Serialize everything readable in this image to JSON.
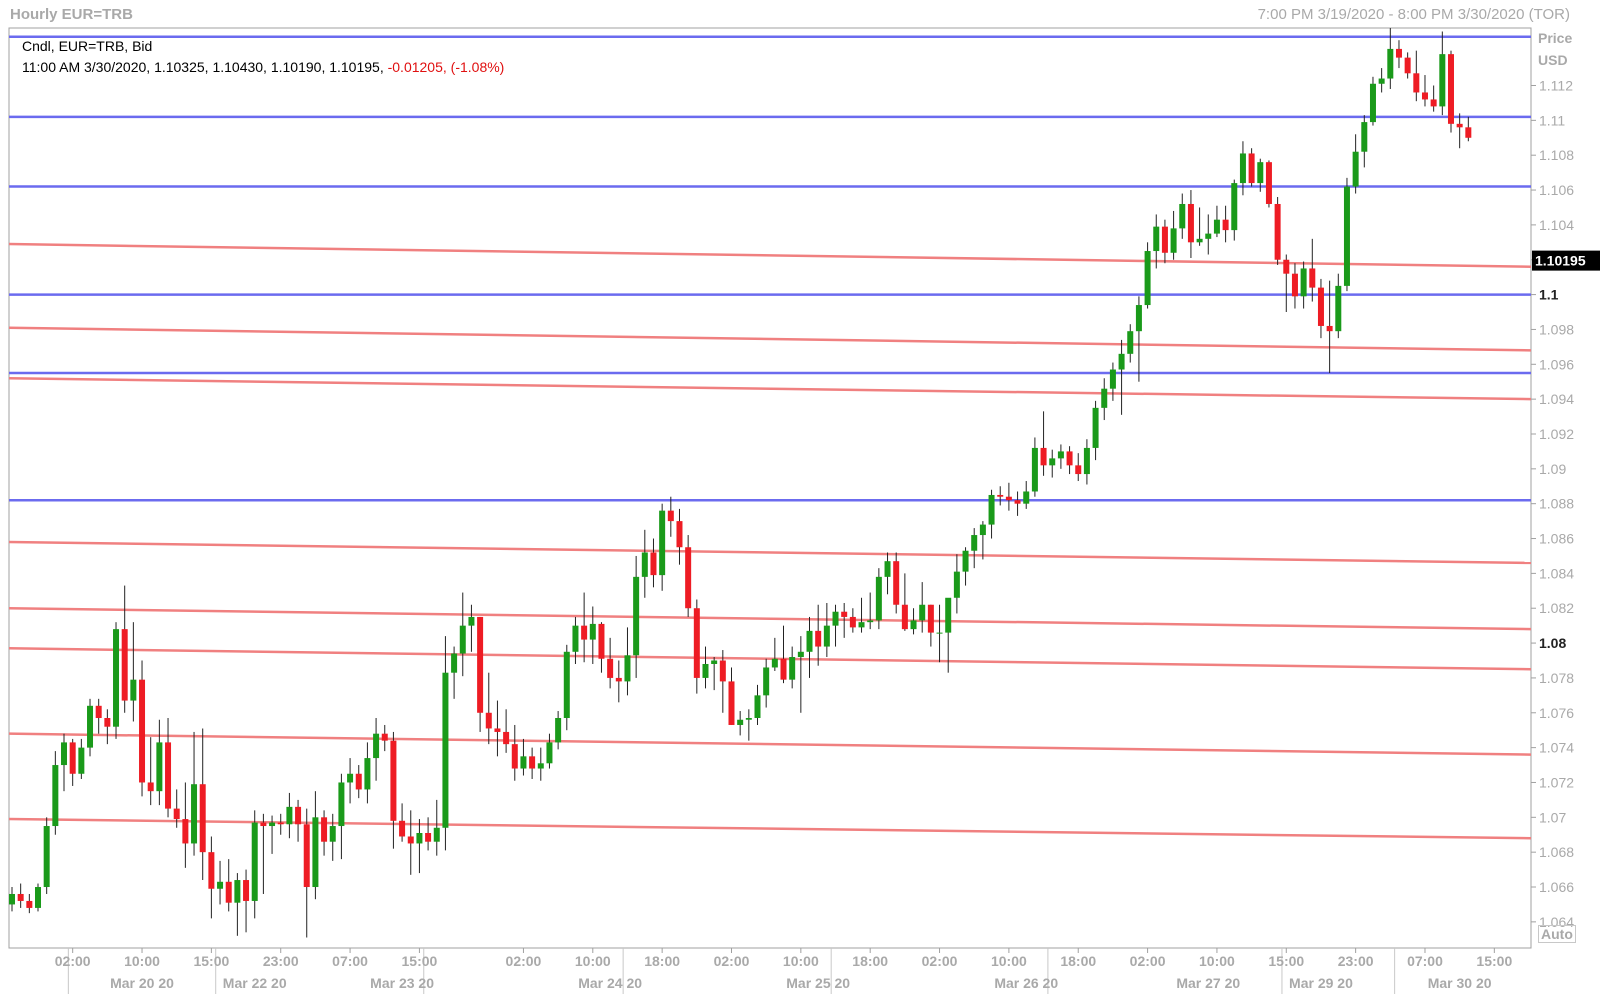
{
  "header": {
    "title": "Hourly EUR=TRB",
    "range": "7:00 PM 3/19/2020 - 8:00 PM 3/30/2020 (TOR)"
  },
  "legend": {
    "line1": "Cndl, EUR=TRB, Bid",
    "line2_ohlc": "11:00 AM 3/30/2020, 1.10325, 1.10430, 1.10190, 1.10195,",
    "line2_change": "-0.01205, (-1.08%)"
  },
  "axis": {
    "unit_line1": "Price",
    "unit_line2": "USD",
    "auto_label": "Auto"
  },
  "colors": {
    "up": "#1a9a1a",
    "down": "#ee1c24",
    "support_resistance": "#6b6bef",
    "trend": "#f08080",
    "grid_border": "#a0a0a0",
    "current_price_bg": "#000000"
  },
  "chart_data": {
    "type": "candlestick",
    "ylim": [
      1.0625,
      1.1153
    ],
    "y_ticks": [
      1.064,
      1.066,
      1.068,
      1.07,
      1.072,
      1.074,
      1.076,
      1.078,
      1.08,
      1.082,
      1.084,
      1.086,
      1.088,
      1.09,
      1.092,
      1.094,
      1.096,
      1.098,
      1.1,
      1.102,
      1.104,
      1.106,
      1.108,
      1.11,
      1.112
    ],
    "y_tick_labels": [
      "1.064",
      "1.066",
      "1.068",
      "1.07",
      "1.072",
      "1.074",
      "1.076",
      "1.078",
      "1.08",
      "1.082",
      "1.084",
      "1.086",
      "1.088",
      "1.09",
      "1.092",
      "1.094",
      "1.096",
      "1.098",
      "1.1",
      "1.102",
      "1.104",
      "1.106",
      "1.108",
      "1.11",
      "1.112"
    ],
    "y_bold_ticks": [
      "1.08",
      "1.1"
    ],
    "last_price": "1.10195",
    "candle_count": 173,
    "time_ticks": [
      {
        "index": 7,
        "label": "02:00"
      },
      {
        "index": 15,
        "label": "10:00"
      },
      {
        "index": 23,
        "label": "15:00"
      },
      {
        "index": 31,
        "label": "23:00"
      },
      {
        "index": 39,
        "label": "07:00"
      },
      {
        "index": 47,
        "label": "15:00"
      },
      {
        "index": 59,
        "label": "02:00"
      },
      {
        "index": 67,
        "label": "10:00"
      },
      {
        "index": 75,
        "label": "18:00"
      },
      {
        "index": 83,
        "label": "02:00"
      },
      {
        "index": 91,
        "label": "10:00"
      },
      {
        "index": 99,
        "label": "18:00"
      },
      {
        "index": 107,
        "label": "02:00"
      },
      {
        "index": 115,
        "label": "10:00"
      },
      {
        "index": 123,
        "label": "18:00"
      },
      {
        "index": 131,
        "label": "02:00"
      },
      {
        "index": 139,
        "label": "10:00"
      },
      {
        "index": 147,
        "label": "15:00"
      },
      {
        "index": 155,
        "label": "23:00"
      },
      {
        "index": 163,
        "label": "07:00"
      },
      {
        "index": 171,
        "label": "15:00"
      }
    ],
    "date_ticks": [
      {
        "index": 15,
        "label": "Mar 20 20"
      },
      {
        "index": 28,
        "label": "Mar 22 20"
      },
      {
        "index": 45,
        "label": "Mar 23 20"
      },
      {
        "index": 69,
        "label": "Mar 24 20"
      },
      {
        "index": 93,
        "label": "Mar 25 20"
      },
      {
        "index": 117,
        "label": "Mar 26 20"
      },
      {
        "index": 138,
        "label": "Mar 27 20"
      },
      {
        "index": 151,
        "label": "Mar 29 20"
      },
      {
        "index": 167,
        "label": "Mar 30 20"
      }
    ],
    "date_separators": [
      6.5,
      23.5,
      47.5,
      70.5,
      94.5,
      119.5,
      146.5,
      159.5
    ],
    "horizontal_levels": [
      1.1148,
      1.1102,
      1.1062,
      1.1,
      1.0955,
      1.0882
    ],
    "trend_lines": [
      {
        "start": 1.1029,
        "end": 1.1016
      },
      {
        "start": 1.0981,
        "end": 1.0968
      },
      {
        "start": 1.0952,
        "end": 1.094
      },
      {
        "start": 1.0858,
        "end": 1.0846
      },
      {
        "start": 1.082,
        "end": 1.0808
      },
      {
        "start": 1.0797,
        "end": 1.0785
      },
      {
        "start": 1.0748,
        "end": 1.0736
      },
      {
        "start": 1.0699,
        "end": 1.0688
      }
    ],
    "candles": [
      [
        1.065,
        1.066,
        1.0646,
        1.0656
      ],
      [
        1.0656,
        1.0662,
        1.0648,
        1.0652
      ],
      [
        1.0652,
        1.0656,
        1.0645,
        1.0648
      ],
      [
        1.0648,
        1.0662,
        1.0646,
        1.066
      ],
      [
        1.066,
        1.07,
        1.0656,
        1.0695
      ],
      [
        1.0695,
        1.0738,
        1.069,
        1.073
      ],
      [
        1.073,
        1.0748,
        1.0715,
        1.0743
      ],
      [
        1.0743,
        1.0745,
        1.0718,
        1.0725
      ],
      [
        1.0725,
        1.0745,
        1.0722,
        1.074
      ],
      [
        1.074,
        1.0768,
        1.0735,
        1.0764
      ],
      [
        1.0764,
        1.0768,
        1.0748,
        1.0757
      ],
      [
        1.0757,
        1.0762,
        1.0742,
        1.0752
      ],
      [
        1.0752,
        1.0812,
        1.0745,
        1.0808
      ],
      [
        1.0808,
        1.0833,
        1.076,
        1.0767
      ],
      [
        1.0767,
        1.0812,
        1.0755,
        1.0779
      ],
      [
        1.0779,
        1.079,
        1.0712,
        1.072
      ],
      [
        1.072,
        1.0746,
        1.0707,
        1.0715
      ],
      [
        1.0715,
        1.0756,
        1.0707,
        1.0743
      ],
      [
        1.0743,
        1.0757,
        1.07,
        1.0705
      ],
      [
        1.0705,
        1.0716,
        1.0694,
        1.0699
      ],
      [
        1.0699,
        1.072,
        1.0671,
        1.0685
      ],
      [
        1.0685,
        1.0749,
        1.0678,
        1.0719
      ],
      [
        1.0719,
        1.0751,
        1.0664,
        1.068
      ],
      [
        1.068,
        1.0689,
        1.0642,
        1.0659
      ],
      [
        1.0659,
        1.0675,
        1.065,
        1.0663
      ],
      [
        1.0663,
        1.0676,
        1.0646,
        1.0651
      ],
      [
        1.0651,
        1.0668,
        1.0632,
        1.0664
      ],
      [
        1.0664,
        1.067,
        1.0634,
        1.0652
      ],
      [
        1.0652,
        1.0704,
        1.0642,
        1.0697
      ],
      [
        1.0697,
        1.0702,
        1.0656,
        1.0695
      ],
      [
        1.0695,
        1.0701,
        1.0679,
        1.0697
      ],
      [
        1.0697,
        1.0702,
        1.069,
        1.0696
      ],
      [
        1.0696,
        1.0714,
        1.0688,
        1.0706
      ],
      [
        1.0706,
        1.071,
        1.0686,
        1.0696
      ],
      [
        1.0696,
        1.0705,
        1.0631,
        1.066
      ],
      [
        1.066,
        1.0715,
        1.0653,
        1.07
      ],
      [
        1.07,
        1.0704,
        1.0678,
        1.0686
      ],
      [
        1.0686,
        1.0702,
        1.0675,
        1.0695
      ],
      [
        1.0695,
        1.0725,
        1.0676,
        1.072
      ],
      [
        1.072,
        1.0734,
        1.0708,
        1.0725
      ],
      [
        1.0725,
        1.073,
        1.0711,
        1.0716
      ],
      [
        1.0716,
        1.0743,
        1.0708,
        1.0734
      ],
      [
        1.0734,
        1.0757,
        1.0721,
        1.0748
      ],
      [
        1.0748,
        1.0753,
        1.0738,
        1.0744
      ],
      [
        1.0744,
        1.0749,
        1.0682,
        1.0698
      ],
      [
        1.0698,
        1.0708,
        1.0686,
        1.0689
      ],
      [
        1.0689,
        1.0704,
        1.0667,
        1.0685
      ],
      [
        1.0685,
        1.0699,
        1.0668,
        1.0691
      ],
      [
        1.0691,
        1.07,
        1.0681,
        1.0686
      ],
      [
        1.0686,
        1.071,
        1.0678,
        1.0694
      ],
      [
        1.0694,
        1.0804,
        1.0681,
        1.0783
      ],
      [
        1.0783,
        1.0798,
        1.0768,
        1.0794
      ],
      [
        1.0794,
        1.0829,
        1.0781,
        1.081
      ],
      [
        1.081,
        1.0822,
        1.0795,
        1.0815
      ],
      [
        1.0815,
        1.0815,
        1.0749,
        1.076
      ],
      [
        1.076,
        1.0783,
        1.0742,
        1.0751
      ],
      [
        1.0751,
        1.0767,
        1.0735,
        1.0749
      ],
      [
        1.0749,
        1.0762,
        1.0737,
        1.0742
      ],
      [
        1.0742,
        1.0753,
        1.0721,
        1.0728
      ],
      [
        1.0728,
        1.0745,
        1.0724,
        1.0735
      ],
      [
        1.0735,
        1.074,
        1.0722,
        1.0728
      ],
      [
        1.0728,
        1.074,
        1.0721,
        1.0731
      ],
      [
        1.0731,
        1.0748,
        1.0728,
        1.0743
      ],
      [
        1.0743,
        1.0761,
        1.0739,
        1.0757
      ],
      [
        1.0757,
        1.0799,
        1.075,
        1.0795
      ],
      [
        1.0795,
        1.0815,
        1.0788,
        1.081
      ],
      [
        1.081,
        1.0829,
        1.0789,
        1.0802
      ],
      [
        1.0802,
        1.0821,
        1.0788,
        1.0811
      ],
      [
        1.0811,
        1.0812,
        1.0783,
        1.0791
      ],
      [
        1.0791,
        1.0803,
        1.0774,
        1.078
      ],
      [
        1.078,
        1.079,
        1.0766,
        1.0778
      ],
      [
        1.0778,
        1.0809,
        1.077,
        1.0793
      ],
      [
        1.0793,
        1.085,
        1.078,
        1.0838
      ],
      [
        1.0838,
        1.0865,
        1.0826,
        1.0852
      ],
      [
        1.0852,
        1.086,
        1.0832,
        1.0839
      ],
      [
        1.0839,
        1.088,
        1.083,
        1.0876
      ],
      [
        1.0876,
        1.0884,
        1.0861,
        1.087
      ],
      [
        1.087,
        1.0877,
        1.0845,
        1.0855
      ],
      [
        1.0855,
        1.0862,
        1.0815,
        1.082
      ],
      [
        1.082,
        1.0825,
        1.0771,
        1.078
      ],
      [
        1.078,
        1.0798,
        1.0774,
        1.0788
      ],
      [
        1.0788,
        1.0792,
        1.0773,
        1.079
      ],
      [
        1.079,
        1.0796,
        1.076,
        1.0778
      ],
      [
        1.0778,
        1.0786,
        1.0753,
        1.0753
      ],
      [
        1.0753,
        1.0761,
        1.0747,
        1.0756
      ],
      [
        1.0756,
        1.0762,
        1.0744,
        1.0757
      ],
      [
        1.0757,
        1.0776,
        1.0753,
        1.077
      ],
      [
        1.077,
        1.0791,
        1.0763,
        1.0786
      ],
      [
        1.0786,
        1.0803,
        1.0784,
        1.0791
      ],
      [
        1.0791,
        1.081,
        1.0777,
        1.0779
      ],
      [
        1.0779,
        1.0798,
        1.0774,
        1.0792
      ],
      [
        1.0792,
        1.0804,
        1.076,
        1.0795
      ],
      [
        1.0795,
        1.0815,
        1.078,
        1.0807
      ],
      [
        1.0807,
        1.0822,
        1.0787,
        1.0798
      ],
      [
        1.0798,
        1.0823,
        1.0792,
        1.081
      ],
      [
        1.081,
        1.0822,
        1.0798,
        1.0818
      ],
      [
        1.0818,
        1.0823,
        1.0803,
        1.0815
      ],
      [
        1.0815,
        1.082,
        1.0806,
        1.0809
      ],
      [
        1.0809,
        1.0826,
        1.0806,
        1.0812
      ],
      [
        1.0812,
        1.0829,
        1.0808,
        1.0813
      ],
      [
        1.0813,
        1.0843,
        1.0808,
        1.0838
      ],
      [
        1.0838,
        1.0852,
        1.0828,
        1.0847
      ],
      [
        1.0847,
        1.0852,
        1.0817,
        1.0822
      ],
      [
        1.0822,
        1.084,
        1.0807,
        1.0808
      ],
      [
        1.0808,
        1.082,
        1.0805,
        1.0813
      ],
      [
        1.0813,
        1.0835,
        1.0806,
        1.0822
      ],
      [
        1.0822,
        1.0822,
        1.0798,
        1.0806
      ],
      [
        1.0806,
        1.0822,
        1.0789,
        1.0806
      ],
      [
        1.0806,
        1.082,
        1.0783,
        1.0826
      ],
      [
        1.0826,
        1.0851,
        1.0817,
        1.0841
      ],
      [
        1.0841,
        1.0855,
        1.0833,
        1.0853
      ],
      [
        1.0853,
        1.0866,
        1.0843,
        1.0862
      ],
      [
        1.0862,
        1.087,
        1.0848,
        1.0868
      ],
      [
        1.0868,
        1.0888,
        1.086,
        1.0885
      ],
      [
        1.0885,
        1.089,
        1.0879,
        1.0884
      ],
      [
        1.0884,
        1.0892,
        1.0876,
        1.0882
      ],
      [
        1.0882,
        1.0887,
        1.0873,
        1.088
      ],
      [
        1.088,
        1.0893,
        1.0877,
        1.0887
      ],
      [
        1.0887,
        1.0918,
        1.0884,
        1.0912
      ],
      [
        1.0912,
        1.0933,
        1.0896,
        1.0902
      ],
      [
        1.0902,
        1.0911,
        1.0895,
        1.0906
      ],
      [
        1.0906,
        1.0914,
        1.09,
        1.091
      ],
      [
        1.091,
        1.0913,
        1.0897,
        1.0902
      ],
      [
        1.0902,
        1.0909,
        1.0893,
        1.0897
      ],
      [
        1.0897,
        1.0917,
        1.0891,
        1.0912
      ],
      [
        1.0912,
        1.0939,
        1.0905,
        1.0935
      ],
      [
        1.0935,
        1.0952,
        1.0928,
        1.0946
      ],
      [
        1.0946,
        1.0961,
        1.0939,
        1.0957
      ],
      [
        1.0957,
        1.0974,
        1.0931,
        1.0966
      ],
      [
        1.0966,
        1.0983,
        1.0961,
        1.0979
      ],
      [
        1.0979,
        1.0999,
        1.095,
        1.0994
      ],
      [
        1.0994,
        1.103,
        1.0992,
        1.1025
      ],
      [
        1.1025,
        1.1046,
        1.1015,
        1.1039
      ],
      [
        1.1039,
        1.1043,
        1.1018,
        1.1024
      ],
      [
        1.1024,
        1.1048,
        1.102,
        1.1038
      ],
      [
        1.1038,
        1.1058,
        1.1032,
        1.1052
      ],
      [
        1.1052,
        1.106,
        1.1021,
        1.103
      ],
      [
        1.103,
        1.105,
        1.1028,
        1.1032
      ],
      [
        1.1032,
        1.1046,
        1.1023,
        1.1035
      ],
      [
        1.1035,
        1.1051,
        1.1033,
        1.1043
      ],
      [
        1.1043,
        1.1051,
        1.103,
        1.1037
      ],
      [
        1.1037,
        1.1066,
        1.1031,
        1.1064
      ],
      [
        1.1064,
        1.1088,
        1.1057,
        1.1081
      ],
      [
        1.1081,
        1.1084,
        1.1062,
        1.1064
      ],
      [
        1.1064,
        1.1078,
        1.1059,
        1.1076
      ],
      [
        1.1076,
        1.1077,
        1.105,
        1.1052
      ],
      [
        1.1052,
        1.1056,
        1.1017,
        1.102
      ],
      [
        1.102,
        1.1023,
        1.099,
        1.1012
      ],
      [
        1.1012,
        1.1018,
        1.0992,
        1.0999
      ],
      [
        1.0999,
        1.1019,
        1.0992,
        1.1015
      ],
      [
        1.1015,
        1.1032,
        1.0996,
        1.1004
      ],
      [
        1.1004,
        1.1009,
        1.0975,
        1.0982
      ],
      [
        1.0982,
        1.1008,
        1.0955,
        1.0979
      ],
      [
        1.0979,
        1.1012,
        1.0975,
        1.1005
      ],
      [
        1.1005,
        1.1067,
        1.1002,
        1.1062
      ],
      [
        1.1062,
        1.1092,
        1.1058,
        1.1082
      ],
      [
        1.1082,
        1.1103,
        1.1073,
        1.1099
      ],
      [
        1.1099,
        1.1125,
        1.1097,
        1.1121
      ],
      [
        1.1121,
        1.113,
        1.1116,
        1.1124
      ],
      [
        1.1124,
        1.1153,
        1.1118,
        1.1141
      ],
      [
        1.1141,
        1.1146,
        1.113,
        1.1136
      ],
      [
        1.1136,
        1.1139,
        1.1124,
        1.1127
      ],
      [
        1.1127,
        1.114,
        1.1111,
        1.1116
      ],
      [
        1.1116,
        1.1126,
        1.1108,
        1.1112
      ],
      [
        1.1112,
        1.112,
        1.1105,
        1.1108
      ],
      [
        1.1108,
        1.1151,
        1.1103,
        1.1138
      ],
      [
        1.1138,
        1.114,
        1.1093,
        1.1098
      ],
      [
        1.1098,
        1.1104,
        1.1084,
        1.1096
      ],
      [
        1.1096,
        1.1102,
        1.1088,
        1.109
      ]
    ]
  }
}
